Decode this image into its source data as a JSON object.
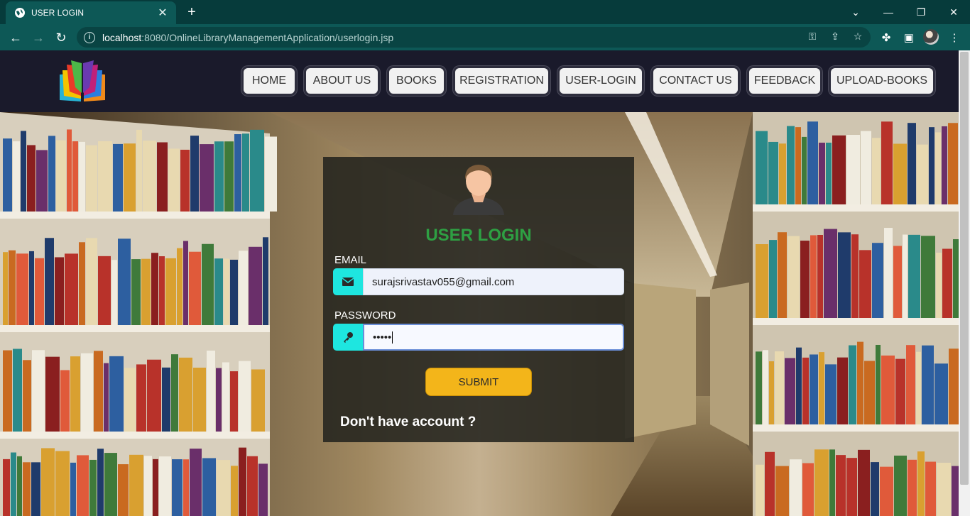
{
  "browser": {
    "tab_title": "USER LOGIN",
    "url_host": "localhost",
    "url_path": ":8080/OnlineLibraryManagementApplication/userlogin.jsp"
  },
  "nav": {
    "items": [
      {
        "label": "HOME"
      },
      {
        "label": "ABOUT US"
      },
      {
        "label": "BOOKS"
      },
      {
        "label": "REGISTRATION"
      },
      {
        "label": "USER-LOGIN"
      },
      {
        "label": "CONTACT US"
      },
      {
        "label": "FEEDBACK"
      },
      {
        "label": "UPLOAD-BOOKS"
      }
    ]
  },
  "login": {
    "title": "USER LOGIN",
    "email_label": "EMAIL",
    "email_value": "surajsrivastav055@gmail.com",
    "password_label": "PASSWORD",
    "password_masked": "•••••",
    "submit_label": "SUBMIT",
    "no_account_text": "Don't have account ?"
  },
  "colors": {
    "title_green": "#2ea043",
    "addon_cyan": "#1ee6e0",
    "submit_yellow": "#f3b51a",
    "header_bg": "#1a1a2b"
  }
}
